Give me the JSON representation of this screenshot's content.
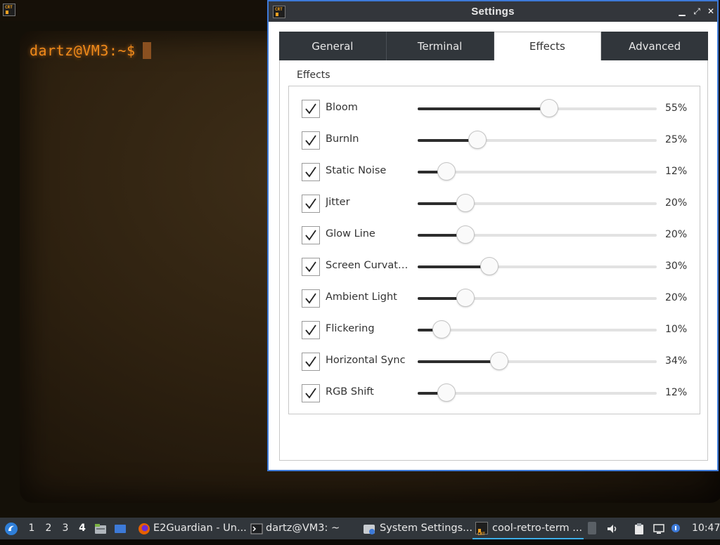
{
  "terminal": {
    "prompt": "dartz@VM3:~$"
  },
  "settings_window": {
    "title": "Settings",
    "buttons": {
      "minimize": "▁",
      "maximize": "⤢",
      "close": "✕"
    },
    "app_icon_text": "CRT",
    "tabs": [
      {
        "label": "General",
        "active": false
      },
      {
        "label": "Terminal",
        "active": false
      },
      {
        "label": "Effects",
        "active": true
      },
      {
        "label": "Advanced",
        "active": false
      }
    ],
    "group_title": "Effects",
    "effects": [
      {
        "label": "Bloom",
        "checked": true,
        "value": 55,
        "value_text": "55%"
      },
      {
        "label": "BurnIn",
        "checked": true,
        "value": 25,
        "value_text": "25%"
      },
      {
        "label": "Static Noise",
        "checked": true,
        "value": 12,
        "value_text": "12%"
      },
      {
        "label": "Jitter",
        "checked": true,
        "value": 20,
        "value_text": "20%"
      },
      {
        "label": "Glow Line",
        "checked": true,
        "value": 20,
        "value_text": "20%"
      },
      {
        "label": "Screen Curvat…",
        "checked": true,
        "value": 30,
        "value_text": "30%"
      },
      {
        "label": "Ambient Light",
        "checked": true,
        "value": 20,
        "value_text": "20%"
      },
      {
        "label": "Flickering",
        "checked": true,
        "value": 10,
        "value_text": "10%"
      },
      {
        "label": "Horizontal Sync",
        "checked": true,
        "value": 34,
        "value_text": "34%"
      },
      {
        "label": "RGB Shift",
        "checked": true,
        "value": 12,
        "value_text": "12%"
      }
    ]
  },
  "taskbar": {
    "workspaces": [
      "1",
      "2",
      "3",
      "4"
    ],
    "active_workspace": "4",
    "launchers": [
      "file-manager-icon",
      "desktop-icon"
    ],
    "tasks": [
      {
        "label": "E2Guardian - Un...",
        "icon": "firefox-icon",
        "active": false
      },
      {
        "label": "dartz@VM3: ~",
        "icon": "terminal-icon",
        "active": false
      },
      {
        "label": "System Settings...",
        "icon": "settings-icon",
        "active": false
      },
      {
        "label": "cool-retro-term ...",
        "icon": "crt-icon",
        "active": true
      }
    ],
    "clock": "10:47"
  },
  "colors": {
    "accent": "#3daee9",
    "panel_dark": "#31363b",
    "terminal_text": "#f08a1a",
    "window_border": "#3d7ad8"
  }
}
